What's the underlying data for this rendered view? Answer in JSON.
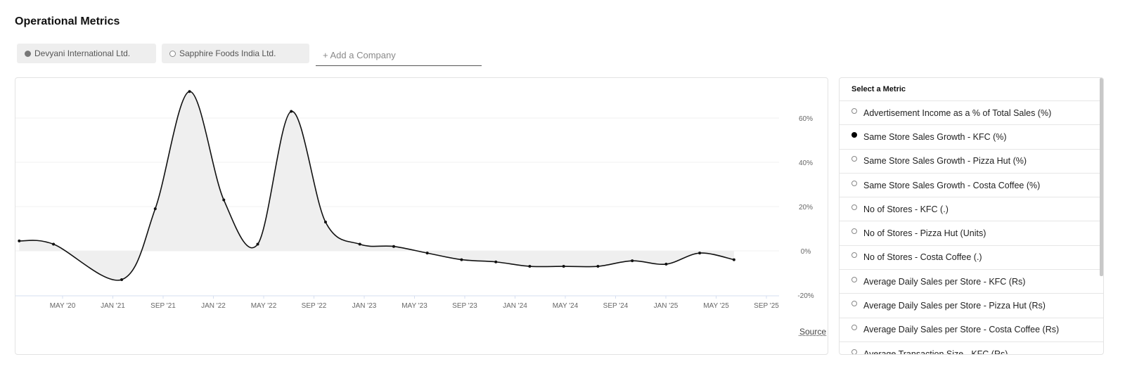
{
  "page": {
    "title": "Operational Metrics"
  },
  "companies": [
    {
      "label": "Devyani International Ltd.",
      "selected": true
    },
    {
      "label": "Sapphire Foods India Ltd.",
      "selected": false
    }
  ],
  "add_company": {
    "placeholder": "+ Add a Company"
  },
  "source_label": "Source",
  "metrics_panel": {
    "header": "Select a Metric",
    "items": [
      {
        "label": "Advertisement Income as a % of Total Sales (%)",
        "selected": false
      },
      {
        "label": "Same Store Sales Growth - KFC (%)",
        "selected": true
      },
      {
        "label": "Same Store Sales Growth - Pizza Hut (%)",
        "selected": false
      },
      {
        "label": "Same Store Sales Growth - Costa Coffee (%)",
        "selected": false
      },
      {
        "label": "No of Stores - KFC (.)",
        "selected": false
      },
      {
        "label": "No of Stores - Pizza Hut (Units)",
        "selected": false
      },
      {
        "label": "No of Stores - Costa Coffee (.)",
        "selected": false
      },
      {
        "label": "Average Daily Sales per Store - KFC (Rs)",
        "selected": false
      },
      {
        "label": "Average Daily Sales per Store - Pizza Hut (Rs)",
        "selected": false
      },
      {
        "label": "Average Daily Sales per Store - Costa Coffee (Rs)",
        "selected": false
      },
      {
        "label": "Average Transaction Size - KFC (Rs)",
        "selected": false
      }
    ]
  },
  "colors": {
    "line": "#111111",
    "area": "#efefef",
    "gridline": "#f1f1f1",
    "axis_line": "#d6dff0",
    "tick_text": "#666666",
    "selected_radio": "#000000"
  },
  "chart_data": {
    "type": "area",
    "x_tick_labels": [
      "MAY '20",
      "JAN '21",
      "SEP '21",
      "JAN '22",
      "MAY '22",
      "SEP '22",
      "JAN '23",
      "MAY '23",
      "SEP '23",
      "JAN '24",
      "MAY '24",
      "SEP '24",
      "JAN '25",
      "MAY '25",
      "SEP '25"
    ],
    "y_tick_labels": [
      "60%",
      "40%",
      "20%",
      "0%",
      "-20%"
    ],
    "ylim": [
      -20,
      60
    ],
    "y_axis_position": "right",
    "grid": true,
    "series": [
      {
        "points": [
          {
            "x": "2020-03",
            "y": 4.5
          },
          {
            "x": "2020-06",
            "y": 3
          },
          {
            "x": "2020-12",
            "y": -13
          },
          {
            "x": "2021-03",
            "y": 19
          },
          {
            "x": "2021-06",
            "y": 72
          },
          {
            "x": "2021-09",
            "y": 23
          },
          {
            "x": "2021-12",
            "y": 3
          },
          {
            "x": "2022-03",
            "y": 63
          },
          {
            "x": "2022-06",
            "y": 13
          },
          {
            "x": "2022-09",
            "y": 3
          },
          {
            "x": "2022-12",
            "y": 2
          },
          {
            "x": "2023-03",
            "y": -1
          },
          {
            "x": "2023-06",
            "y": -4
          },
          {
            "x": "2023-09",
            "y": -5
          },
          {
            "x": "2023-12",
            "y": -7
          },
          {
            "x": "2024-03",
            "y": -7
          },
          {
            "x": "2024-06",
            "y": -7
          },
          {
            "x": "2024-09",
            "y": -4.5
          },
          {
            "x": "2024-12",
            "y": -6
          },
          {
            "x": "2025-03",
            "y": -1
          },
          {
            "x": "2025-06",
            "y": -4
          }
        ]
      }
    ]
  }
}
